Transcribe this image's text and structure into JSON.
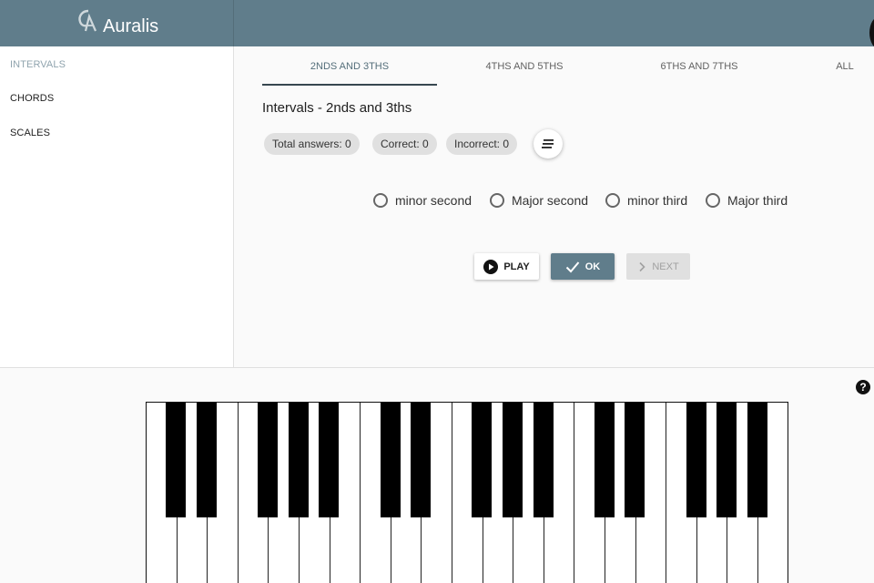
{
  "app": {
    "name": "Auralis"
  },
  "sidebar": {
    "items": [
      {
        "label": "INTERVALS",
        "active": true
      },
      {
        "label": "CHORDS",
        "active": false
      },
      {
        "label": "SCALES",
        "active": false
      }
    ]
  },
  "tabs": [
    {
      "label": "2NDS AND 3THS",
      "active": true
    },
    {
      "label": "4THS AND 5THS",
      "active": false
    },
    {
      "label": "6THS AND 7THS",
      "active": false
    },
    {
      "label": "ALL",
      "active": false
    }
  ],
  "exercise": {
    "title": "Intervals - 2nds and 3ths",
    "stats": {
      "total": "Total answers: 0",
      "correct": "Correct: 0",
      "incorrect": "Incorrect: 0"
    },
    "options": [
      "minor second",
      "Major second",
      "minor third",
      "Major third"
    ],
    "buttons": {
      "play": "PLAY",
      "ok": "OK",
      "next": "NEXT"
    }
  },
  "help": {
    "label": "?"
  },
  "colors": {
    "primary": "#607d8b",
    "active_nav": "#90a4ae"
  },
  "icons": {
    "logo": "auralis-logo-icon",
    "play": "play-circle-icon",
    "ok": "check-icon",
    "next": "chevron-right-icon",
    "sort": "sort-icon",
    "help": "help-icon"
  }
}
